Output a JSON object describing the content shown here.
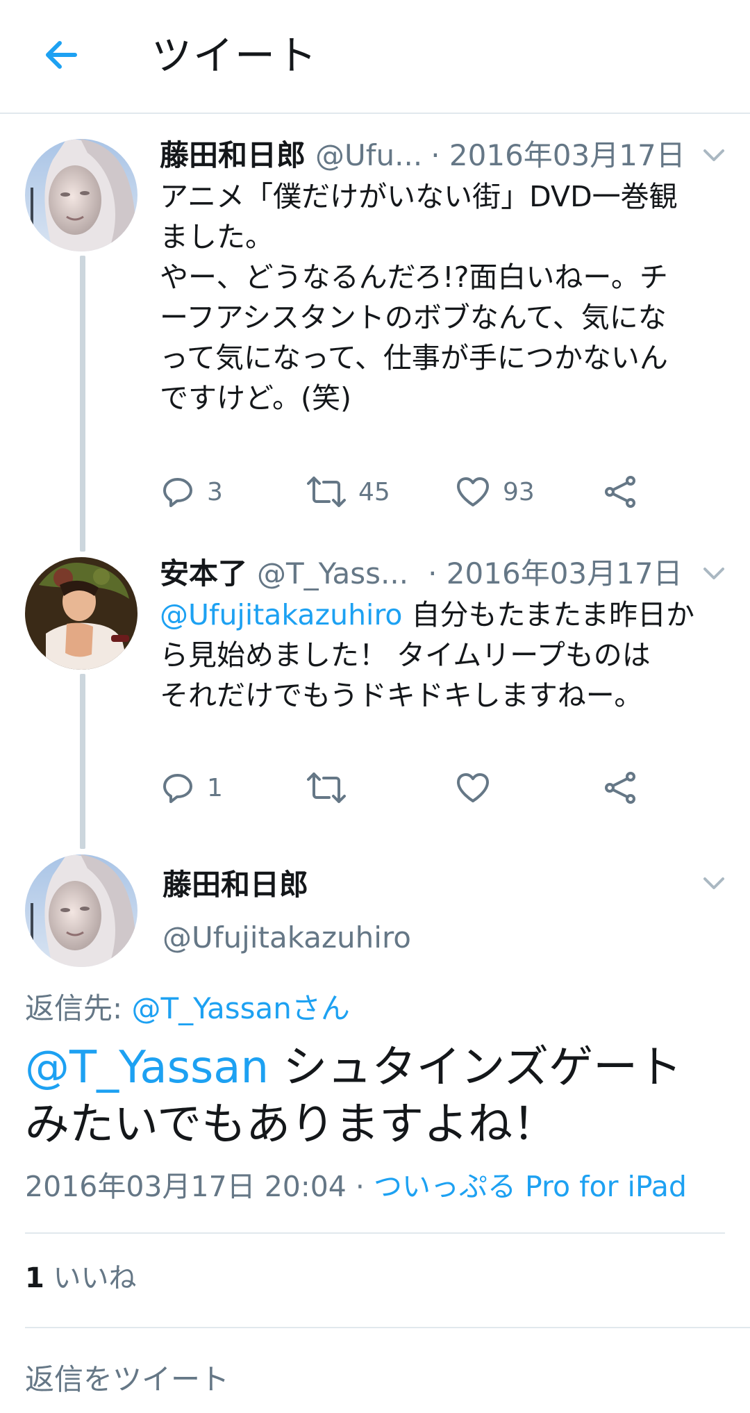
{
  "header": {
    "title": "ツイート"
  },
  "tweets": [
    {
      "name": "藤田和日郎",
      "handle": "@Ufu...",
      "date": "· 2016年03月17日",
      "lines": [
        "アニメ「僕だけがいない街」DVD一巻観",
        "ました。",
        "やー、どうなるんだろ!?面白いねー。チ",
        "ーフアシスタントのボブなんて、気にな",
        "って気になって、仕事が手につかないん",
        "ですけど。(笑)"
      ],
      "reply_count": "3",
      "retweet_count": "45",
      "like_count": "93"
    },
    {
      "name": "安本了",
      "handle": "@T_Yass...",
      "date": "· 2016年03月17日",
      "mention": "@Ufujitakazuhiro",
      "lines": [
        " 自分もたまたま昨日か",
        "ら見始めました！ タイムリープものは",
        "それだけでもうドキドキしますねー。"
      ],
      "reply_count": "1",
      "retweet_count": "",
      "like_count": ""
    }
  ],
  "main_tweet": {
    "name": "藤田和日郎",
    "handle": "@Ufujitakazuhiro",
    "reply_to_label": "返信先: ",
    "reply_to_user": "@T_Yassanさん",
    "mention": "@T_Yassan",
    "text_line1": " シュタインズゲート",
    "text_line2": "みたいでもありますよね！",
    "timestamp": "2016年03月17日 20:04 · ",
    "source": "ついっぷる Pro for iPad",
    "likes_count": "1",
    "likes_label": " いいね"
  },
  "reply_placeholder": "返信をツイート",
  "colors": {
    "accent": "#1da1f2",
    "secondary_text": "#657786",
    "divider": "#e1e8ed",
    "thread_line": "#ccd6dd"
  }
}
